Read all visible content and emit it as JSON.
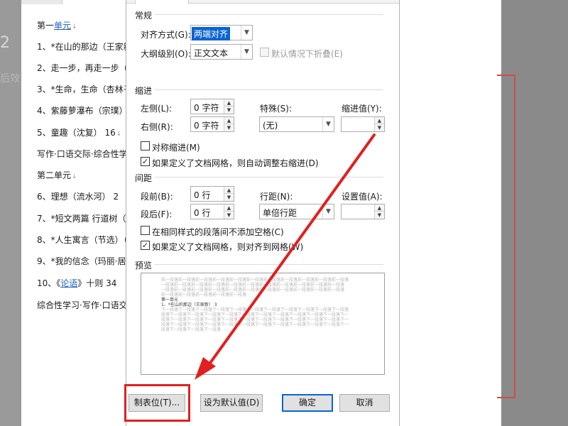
{
  "document": {
    "lines": [
      {
        "prefix": "第一",
        "link": "单元",
        "suffix": ""
      },
      {
        "prefix": "1、*在山的那边（王家新",
        "link": "",
        "suffix": ""
      },
      {
        "prefix": "2、走一步，再走一步（",
        "link": "",
        "suffix": ""
      },
      {
        "prefix": "3、*生命，生命（杏林子",
        "link": "",
        "suffix": ""
      },
      {
        "prefix": "4、紫藤萝瀑布（宗璞）",
        "link": "",
        "suffix": ""
      },
      {
        "prefix": "5、童趣（沈复）  16",
        "link": "",
        "suffix": ""
      },
      {
        "prefix": "写作·口语交际·综合性学",
        "link": "",
        "suffix": ""
      },
      {
        "prefix": "第二单元",
        "link": "",
        "suffix": ""
      },
      {
        "prefix": "6、理想（流水河）   2",
        "link": "",
        "suffix": ""
      },
      {
        "prefix": "7、*短文两篇  行道树（",
        "link": "",
        "suffix": ""
      },
      {
        "prefix": "8、*人生寓言（节选）（",
        "link": "",
        "suffix": ""
      },
      {
        "prefix": "9、*我的信念（玛丽·居里",
        "link": "",
        "suffix": ""
      },
      {
        "prefix": "10、《",
        "link": "论语",
        "suffix": "》十则    34"
      },
      {
        "prefix": "综合性学习·写作·口语交",
        "link": "",
        "suffix": ""
      }
    ],
    "ghost_char": "2",
    "ghost_hou": "后效"
  },
  "dialog": {
    "general": {
      "section": "常规",
      "alignment_label": "对齐方式(G):",
      "alignment_value": "两端对齐",
      "outline_label": "大纲级别(O):",
      "outline_value": "正文文本",
      "collapse_label": "默认情况下折叠(E)"
    },
    "indent": {
      "section": "缩进",
      "left_label": "左侧(L):",
      "left_value": "0 字符",
      "right_label": "右侧(R):",
      "right_value": "0 字符",
      "special_label": "特殊(S):",
      "special_value": "(无)",
      "by_label": "缩进值(Y):",
      "by_value": "",
      "mirror_label": "对称缩进(M)",
      "auto_adjust_label": "如果定义了文档网格，则自动调整右缩进(D)"
    },
    "spacing": {
      "section": "间距",
      "before_label": "段前(B):",
      "before_value": "0 行",
      "after_label": "段后(F):",
      "after_value": "0 行",
      "line_label": "行距(N):",
      "line_value": "单倍行距",
      "at_label": "设置值(A):",
      "at_value": "",
      "no_space_label": "在相同样式的段落间不添加空格(C)",
      "snap_grid_label": "如果定义了文档网格，则对齐到网格(W)"
    },
    "preview": {
      "section": "预览",
      "prev_lines": [
        "前一段落前一段落前一段落前一段落前一段落前一段落前一段落前一段落前一段落前一段落前一段落",
        "一段落前一段落前一段落前一段落前一段落前一段落前一段落前一段落前一段落前一段落前一段落",
        "一段落前一段落前一段落前一段落前一段落前一段落前一段落前一段落前一段落前一段落前一段落",
        "前一段落前一段落前一段落前一段落前一段落"
      ],
      "current_lines": [
        "第一单元",
        "1、*在山的那边（王家新）      3"
      ],
      "next_lines": [
        "下一段落下一段落下一段落下一段落下一段落下一段落下一段落下一段落下一段落下一段落下一段落",
        "段落下一段落下一段落下一段落下一段落下一段落下一段落下一段落下一段落下一段落下一段落下一",
        "段落下一段落下一段落下一段落下一段落下一段落下一段落下一段落下一段落下一段落下一段落下一",
        "段落下一段落下一段落下一段落下一段落下一段落下一段落下一段落下一段落下一段落下一段落下一",
        "段落下一段落下一段落下一段落"
      ]
    },
    "buttons": {
      "tabs": "制表位(T)...",
      "set_default": "设为默认值(D)",
      "ok": "确定",
      "cancel": "取消"
    }
  },
  "colors": {
    "annotation_red": "#e02020",
    "selection_blue": "#0a64d2",
    "link_blue": "#1f5fbf"
  }
}
